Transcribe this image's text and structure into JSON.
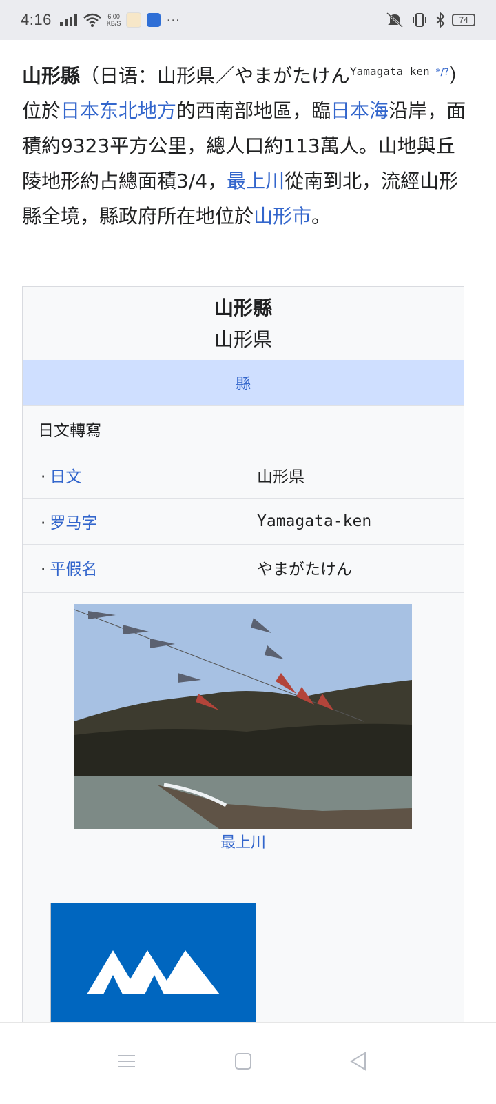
{
  "status": {
    "time": "4:16",
    "speed_value": "6.00",
    "speed_unit": "KB/S",
    "more": "···",
    "battery": "74"
  },
  "article": {
    "title_bold": "山形縣",
    "open_paren": "（日语：山形県／やまがたけん",
    "romaji": "Yamagata ken",
    "audio": "*/?",
    "text1": "）位於",
    "link_tohoku": "日本东北地方",
    "text2": "的西南部地區，臨",
    "link_sea": "日本海",
    "text3": "沿岸，面積約9323平方公里，總人口約113萬人。山地與丘陵地形約占總面積3/4，",
    "link_river": "最上川",
    "text4": "從南到北，流經山形縣全境，縣政府所在地位於",
    "link_city": "山形市",
    "text5": "。"
  },
  "infobox": {
    "title": "山形縣",
    "subtitle": "山形県",
    "type": "縣",
    "section_header": "日文轉寫",
    "rows": [
      {
        "label": "日文",
        "value": "山形県"
      },
      {
        "label": "罗马字",
        "value": "Yamagata-ken"
      },
      {
        "label": "平假名",
        "value": "やまがたけん"
      }
    ],
    "photo_caption": "最上川"
  },
  "colors": {
    "link": "#3366cc",
    "type_band": "#cfdfff",
    "flag_blue": "#0066bf"
  }
}
